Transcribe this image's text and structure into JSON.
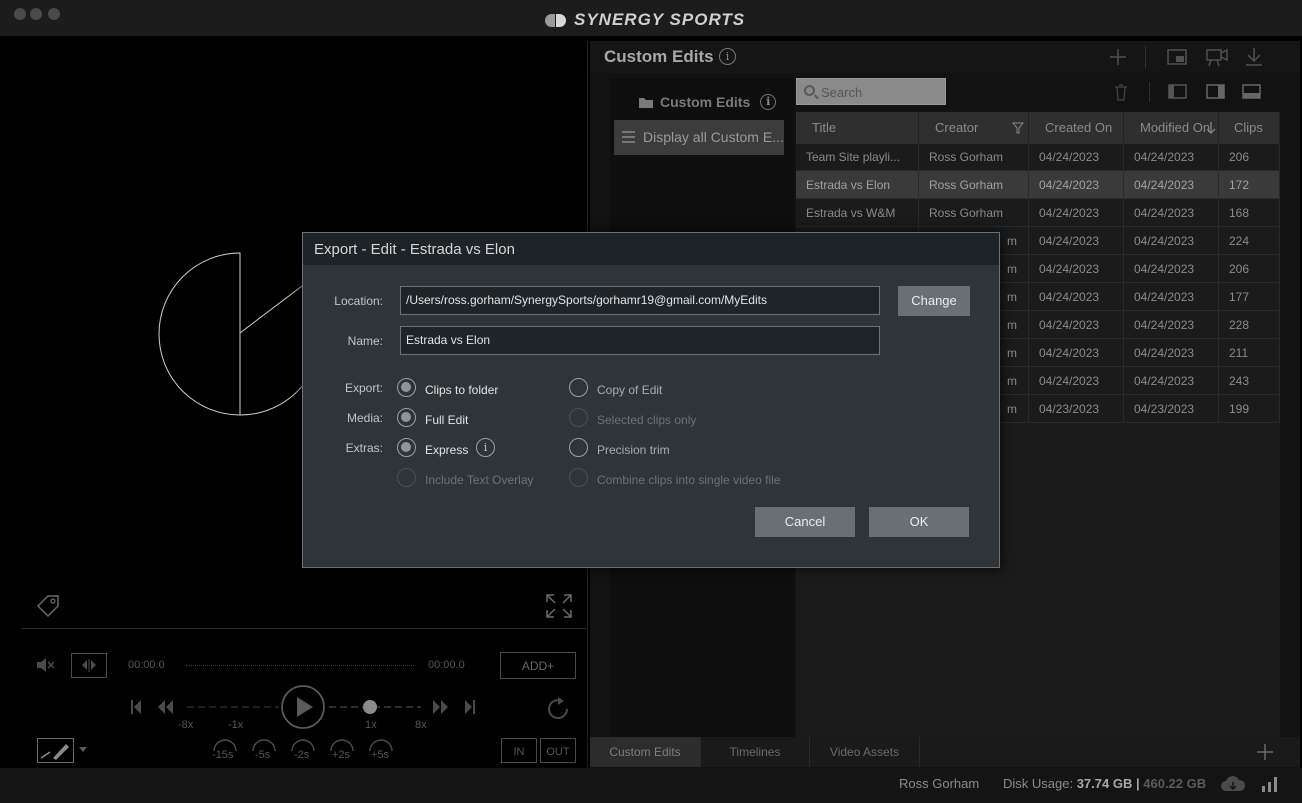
{
  "app": {
    "brand": "SYNERGY SPORTS"
  },
  "player": {
    "time_start": "00:00.0",
    "time_end": "00:00.0",
    "add_label": "ADD+",
    "speed_labels": [
      "-8x",
      "-1x",
      "1x",
      "8x"
    ],
    "skip_labels": [
      "-15s",
      "-5s",
      "-2s",
      "+2s",
      "+5s"
    ],
    "in_label": "IN",
    "out_label": "OUT"
  },
  "panel": {
    "title": "Custom Edits",
    "folder_title": "Custom Edits",
    "folder_item": "Display all Custom E...",
    "search_placeholder": "Search",
    "columns": [
      "Title",
      "Creator",
      "Created On",
      "Modified On",
      "Clips"
    ],
    "rows": [
      {
        "title": "Team Site playli...",
        "creator": "Ross Gorham",
        "created": "04/24/2023",
        "modified": "04/24/2023",
        "clips": "206",
        "selected": false
      },
      {
        "title": "Estrada vs Elon",
        "creator": "Ross Gorham",
        "created": "04/24/2023",
        "modified": "04/24/2023",
        "clips": "172",
        "selected": true
      },
      {
        "title": "Estrada vs W&M",
        "creator": "Ross Gorham",
        "created": "04/24/2023",
        "modified": "04/24/2023",
        "clips": "168",
        "selected": false
      },
      {
        "title": "",
        "creator": "m",
        "created": "04/24/2023",
        "modified": "04/24/2023",
        "clips": "224",
        "selected": false
      },
      {
        "title": "",
        "creator": "m",
        "created": "04/24/2023",
        "modified": "04/24/2023",
        "clips": "206",
        "selected": false
      },
      {
        "title": "",
        "creator": "m",
        "created": "04/24/2023",
        "modified": "04/24/2023",
        "clips": "177",
        "selected": false
      },
      {
        "title": "",
        "creator": "m",
        "created": "04/24/2023",
        "modified": "04/24/2023",
        "clips": "228",
        "selected": false
      },
      {
        "title": "",
        "creator": "m",
        "created": "04/24/2023",
        "modified": "04/24/2023",
        "clips": "211",
        "selected": false
      },
      {
        "title": "",
        "creator": "m",
        "created": "04/24/2023",
        "modified": "04/24/2023",
        "clips": "243",
        "selected": false
      },
      {
        "title": "",
        "creator": "m",
        "created": "04/23/2023",
        "modified": "04/23/2023",
        "clips": "199",
        "selected": false
      }
    ],
    "tabs": [
      "Custom Edits",
      "Timelines",
      "Video Assets"
    ]
  },
  "status": {
    "user": "Ross Gorham",
    "disk_label": "Disk Usage:",
    "disk_used": "37.74 GB",
    "disk_sep": "|",
    "disk_total": "460.22 GB"
  },
  "dialog": {
    "title": "Export - Edit - Estrada vs Elon",
    "location_label": "Location:",
    "location_value": "/Users/ross.gorham/SynergySports/gorhamr19@gmail.com/MyEdits",
    "change_label": "Change",
    "name_label": "Name:",
    "name_value": "Estrada vs Elon",
    "export_label": "Export:",
    "media_label": "Media:",
    "extras_label": "Extras:",
    "opt_clips_to_folder": "Clips to folder",
    "opt_copy_of_edit": "Copy of Edit",
    "opt_full_edit": "Full Edit",
    "opt_selected_clips": "Selected clips only",
    "opt_express": "Express",
    "opt_precision_trim": "Precision trim",
    "opt_text_overlay": "Include Text Overlay",
    "opt_combine": "Combine clips into single video file",
    "cancel_label": "Cancel",
    "ok_label": "OK"
  }
}
